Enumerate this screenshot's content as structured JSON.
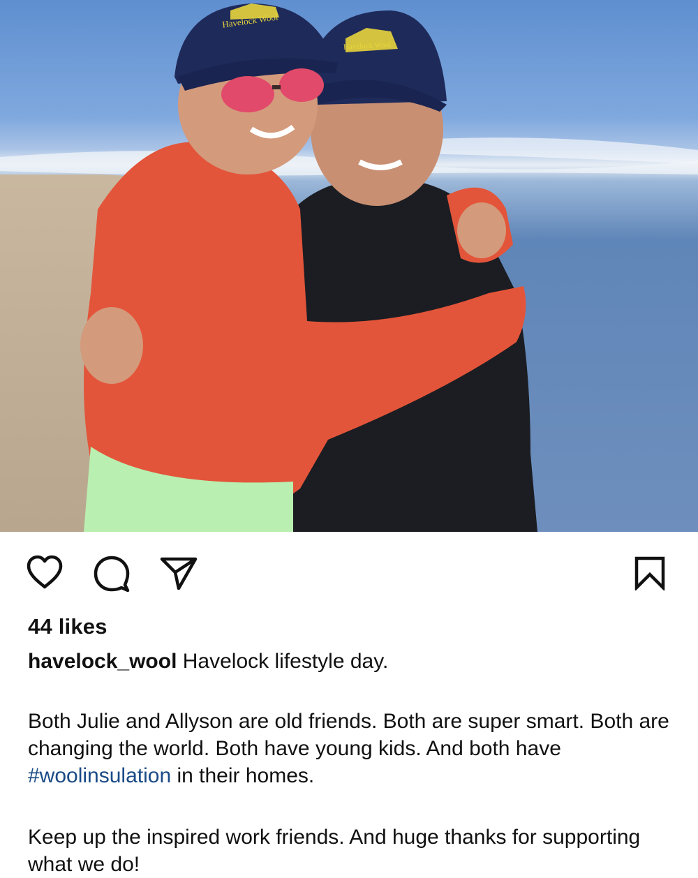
{
  "post": {
    "photo_alt": "",
    "hat_text": "Havelock Wool",
    "likes_text": "44 likes",
    "username": "havelock_wool",
    "caption_first": "Havelock lifestyle day.",
    "paragraph2": {
      "before": "Both Julie and Allyson are old friends. Both are super smart. Both are changing the world. Both have young kids. And both have ",
      "hashtag": "#woolinsulation",
      "after": " in their homes."
    },
    "paragraph3": "Keep up the inspired work friends. And huge thanks for supporting what we do!"
  },
  "actions": {
    "like_icon": "heart-icon",
    "comment_icon": "comment-bubble-icon",
    "share_icon": "paper-plane-icon",
    "save_icon": "bookmark-icon"
  },
  "colors": {
    "hashtag": "#1a4a86",
    "text": "#111111"
  }
}
